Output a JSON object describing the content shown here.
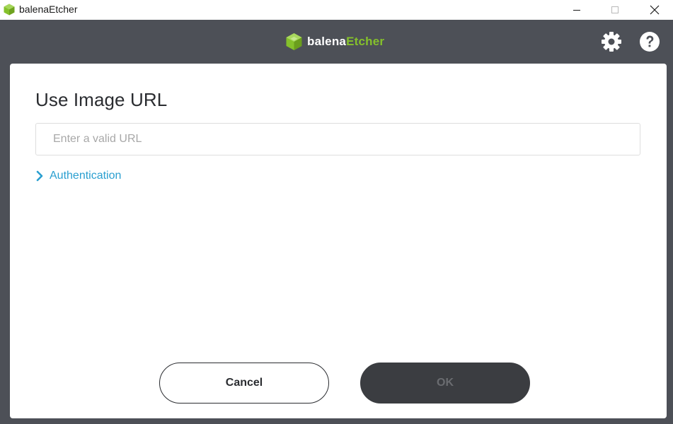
{
  "window": {
    "title": "balenaEtcher",
    "controls": {
      "minimize": "minimize",
      "maximize": "maximize",
      "close": "close"
    }
  },
  "header": {
    "brand_part1": "balena",
    "brand_part2": "Etcher",
    "brand_accent_color": "#85c12b",
    "icons": [
      "settings-icon",
      "help-icon"
    ]
  },
  "modal": {
    "title": "Use Image URL",
    "url_input": {
      "placeholder": "Enter a valid URL",
      "value": ""
    },
    "authentication_label": "Authentication",
    "cancel_label": "Cancel",
    "ok_label": "OK"
  },
  "colors": {
    "header_bg": "#4d5057",
    "link": "#2a9fd0",
    "ok_button_bg": "#3b3d41"
  }
}
